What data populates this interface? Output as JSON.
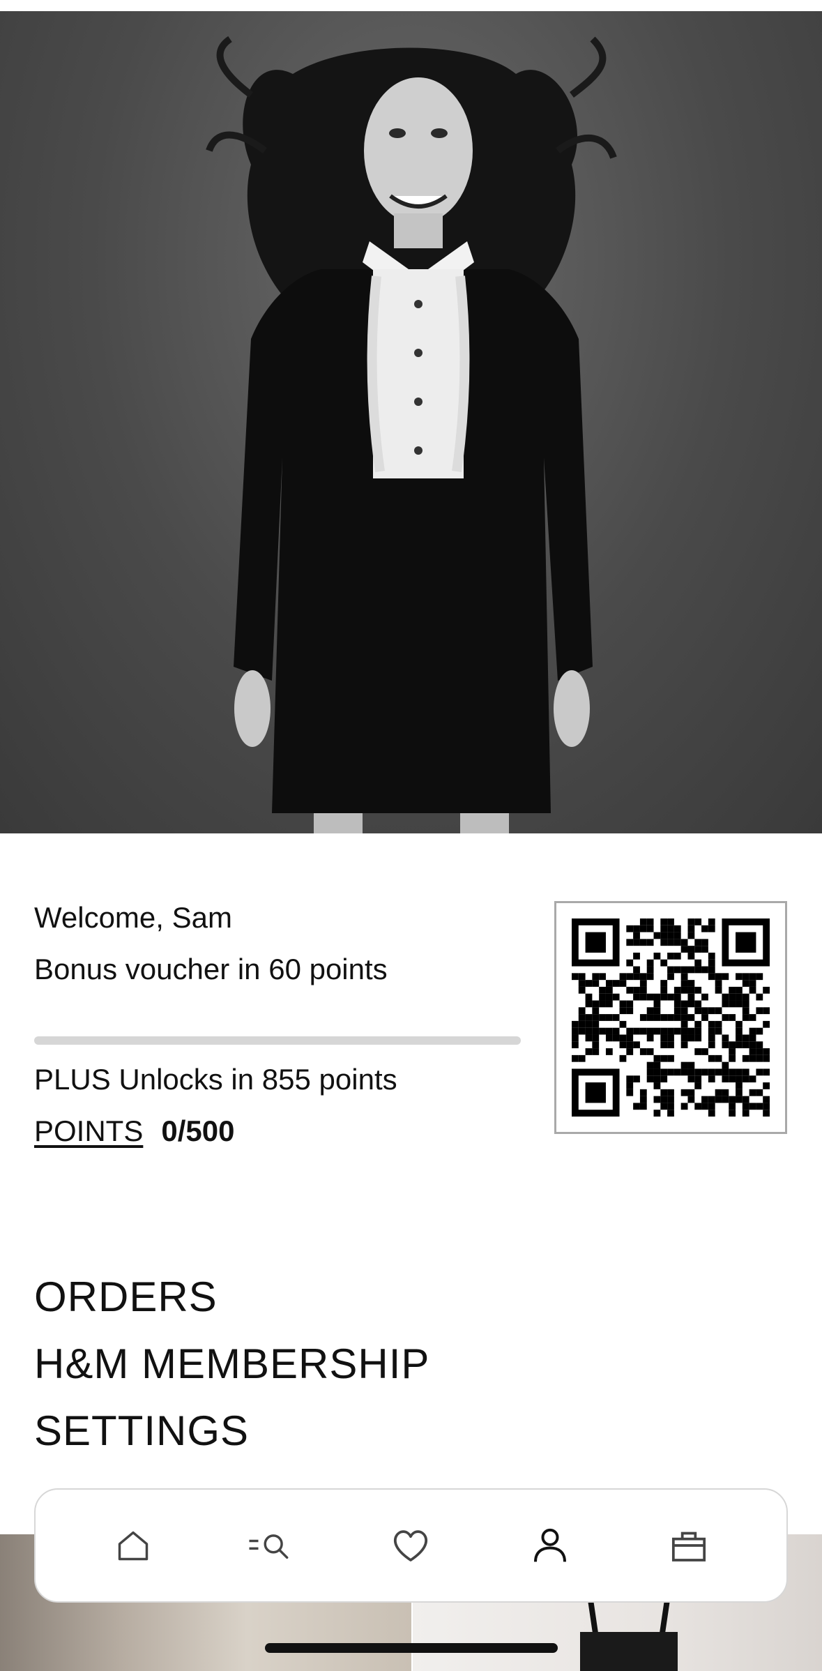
{
  "account": {
    "welcome": "Welcome, Sam",
    "bonus": "Bonus voucher in 60 points",
    "plus": "PLUS Unlocks in 855 points",
    "points_label": "POINTS",
    "points_value": "0/500",
    "progress": 0
  },
  "menu": {
    "orders": "ORDERS",
    "membership": "H&M MEMBERSHIP",
    "settings": "SETTINGS"
  },
  "nav": {
    "items": [
      "home-icon",
      "search-icon",
      "heart-icon",
      "account-icon",
      "bag-icon"
    ],
    "active": "account-icon"
  },
  "colors": {
    "text": "#111111",
    "track": "#d6d6d6",
    "nav_border": "#d7d7d7"
  }
}
